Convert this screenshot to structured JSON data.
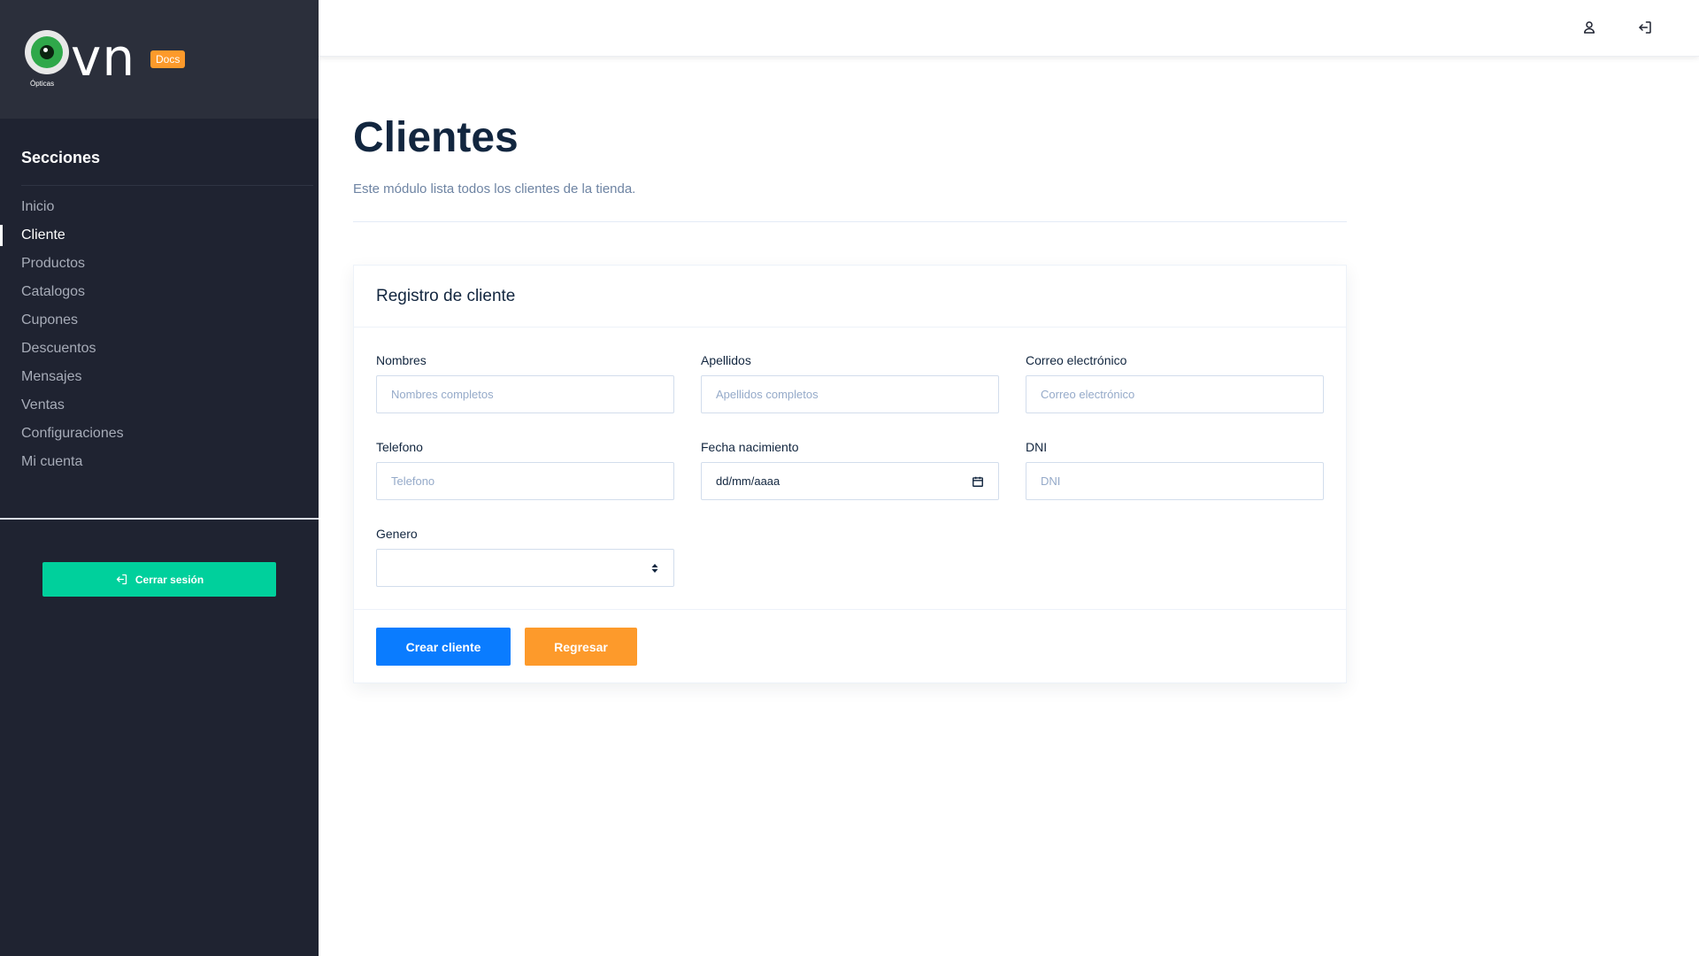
{
  "brand": {
    "logo_text": "vn",
    "logo_subtext": "Ópticas",
    "badge": "Docs"
  },
  "sidebar": {
    "section_title": "Secciones",
    "items": [
      {
        "label": "Inicio",
        "active": false
      },
      {
        "label": "Cliente",
        "active": true
      },
      {
        "label": "Productos",
        "active": false
      },
      {
        "label": "Catalogos",
        "active": false
      },
      {
        "label": "Cupones",
        "active": false
      },
      {
        "label": "Descuentos",
        "active": false
      },
      {
        "label": "Mensajes",
        "active": false
      },
      {
        "label": "Ventas",
        "active": false
      },
      {
        "label": "Configuraciones",
        "active": false
      },
      {
        "label": "Mi cuenta",
        "active": false
      }
    ],
    "logout_label": "Cerrar sesión"
  },
  "header": {
    "icons": [
      "user-icon",
      "logout-icon"
    ]
  },
  "page": {
    "title": "Clientes",
    "subtitle": "Este módulo lista todos los clientes de la tienda."
  },
  "card": {
    "title": "Registro de cliente",
    "fields": {
      "nombres": {
        "label": "Nombres",
        "placeholder": "Nombres completos"
      },
      "apellidos": {
        "label": "Apellidos",
        "placeholder": "Apellidos completos"
      },
      "correo": {
        "label": "Correo electrónico",
        "placeholder": "Correo electrónico"
      },
      "telefono": {
        "label": "Telefono",
        "placeholder": "Telefono"
      },
      "fecha": {
        "label": "Fecha nacimiento",
        "value": "dd/mm/aaaa"
      },
      "dni": {
        "label": "DNI",
        "placeholder": "DNI"
      },
      "genero": {
        "label": "Genero",
        "value": ""
      }
    },
    "buttons": {
      "create": "Crear cliente",
      "back": "Regresar"
    }
  },
  "colors": {
    "sidebar_bg": "#1f2331",
    "brand_bg": "#2b2f3b",
    "accent_teal": "#00d09c",
    "primary_blue": "#0a7cff",
    "warning_orange": "#fd9a2b"
  }
}
